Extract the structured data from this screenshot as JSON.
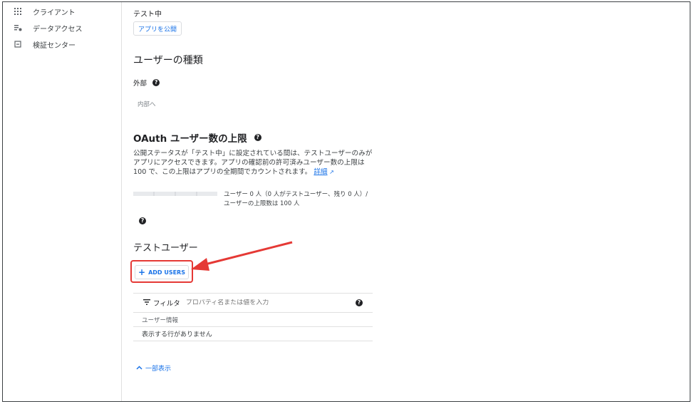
{
  "sidebar": {
    "items": [
      {
        "label": "クライアント",
        "icon": "grid-icon"
      },
      {
        "label": "データアクセス",
        "icon": "data-access-icon"
      },
      {
        "label": "検証センター",
        "icon": "verification-icon"
      }
    ]
  },
  "publishing": {
    "status": "テスト中",
    "publish_button": "アプリを公開"
  },
  "user_type": {
    "heading": "ユーザーの種類",
    "value": "外部",
    "make_internal": "内部へ"
  },
  "oauth_limit": {
    "heading": "OAuth ユーザー数の上限",
    "description": "公開ステータスが「テスト中」に設定されている間は、テストユーザーのみがアプリにアクセスできます。アプリの確認前の許可済みユーザー数の上限は 100 で、この上限はアプリの全期間でカウントされます。",
    "learn_more": "詳細",
    "usage_text": "ユーザー 0 人（0 人がテストユーザー、残り 0 人）/ ユーザーの上限数は 100 人",
    "usage_fraction": 0
  },
  "test_users": {
    "heading": "テストユーザー",
    "add_button": "ADD USERS",
    "filter_label": "フィルタ",
    "filter_placeholder": "プロパティ名または値を入力",
    "column_header": "ユーザー情報",
    "empty_message": "表示する行がありません",
    "show_less": "一部表示"
  },
  "colors": {
    "accent": "#1a73e8",
    "annotation": "#e53935"
  }
}
